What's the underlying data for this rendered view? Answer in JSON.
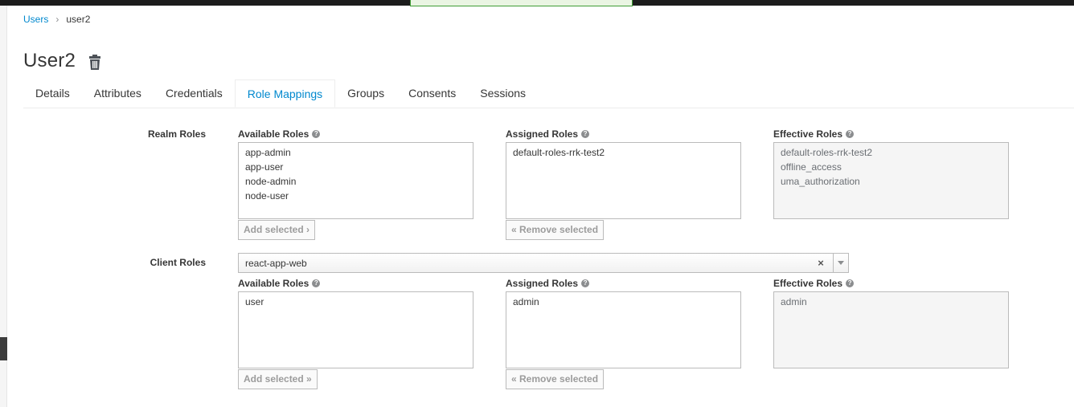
{
  "breadcrumb": {
    "parent": "Users",
    "separator": "›",
    "current": "user2"
  },
  "page": {
    "title": "User2"
  },
  "tabs": [
    "Details",
    "Attributes",
    "Credentials",
    "Role Mappings",
    "Groups",
    "Consents",
    "Sessions"
  ],
  "active_tab": "Role Mappings",
  "realm_roles": {
    "label": "Realm Roles",
    "available_label": "Available Roles",
    "assigned_label": "Assigned Roles",
    "effective_label": "Effective Roles",
    "available": [
      "app-admin",
      "app-user",
      "node-admin",
      "node-user"
    ],
    "assigned": [
      "default-roles-rrk-test2"
    ],
    "effective": [
      "default-roles-rrk-test2",
      "offline_access",
      "uma_authorization"
    ],
    "add_button": "Add selected ›",
    "remove_button": "« Remove selected"
  },
  "client_roles": {
    "label": "Client Roles",
    "client_select_value": "react-app-web",
    "clear_symbol": "×",
    "available_label": "Available Roles",
    "assigned_label": "Assigned Roles",
    "effective_label": "Effective Roles",
    "available": [
      "user"
    ],
    "assigned": [
      "admin"
    ],
    "effective": [
      "admin"
    ],
    "add_button": "Add selected »",
    "remove_button": "« Remove selected"
  },
  "help_icon": "?",
  "colors": {
    "link": "#0088ce",
    "text": "#363636",
    "border": "#bbbbbb",
    "toast_border": "#3f9c35"
  }
}
